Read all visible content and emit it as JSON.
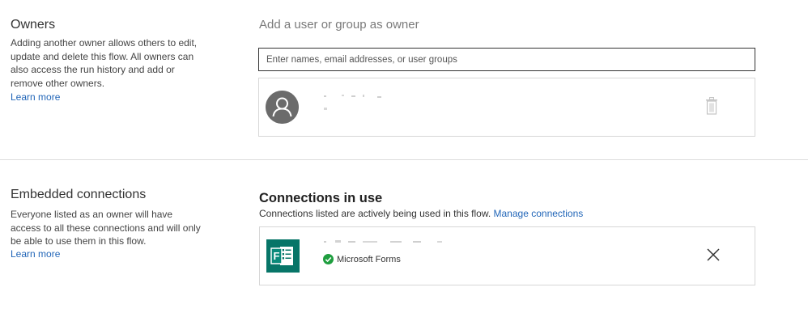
{
  "owners": {
    "title": "Owners",
    "description": "Adding another owner allows others to edit, update and delete this flow. All owners can also access the run history and add or remove other owners.",
    "learn_more": "Learn more",
    "add_label": "Add a user or group as owner",
    "input_placeholder": "Enter names, email addresses, or user groups",
    "input_value": "",
    "owner_list": [
      {
        "avatar": "person-icon",
        "name": "",
        "action_icon": "trash-icon"
      }
    ]
  },
  "embedded_connections": {
    "title": "Embedded connections",
    "description": "Everyone listed as an owner will have access to all these connections and will only be able to use them in this flow.",
    "learn_more": "Learn more",
    "connections_title": "Connections in use",
    "connections_subtitle": "Connections listed are actively being used in this flow.",
    "manage_link": "Manage connections",
    "connections": [
      {
        "icon": "microsoft-forms-icon",
        "status_icon": "check-circle-icon",
        "service": "Microsoft Forms",
        "action_icon": "close-icon"
      }
    ]
  },
  "colors": {
    "link": "#2266b8",
    "forms_green": "#077568",
    "status_green": "#1f9e3f",
    "avatar_gray": "#6b6b6b"
  }
}
